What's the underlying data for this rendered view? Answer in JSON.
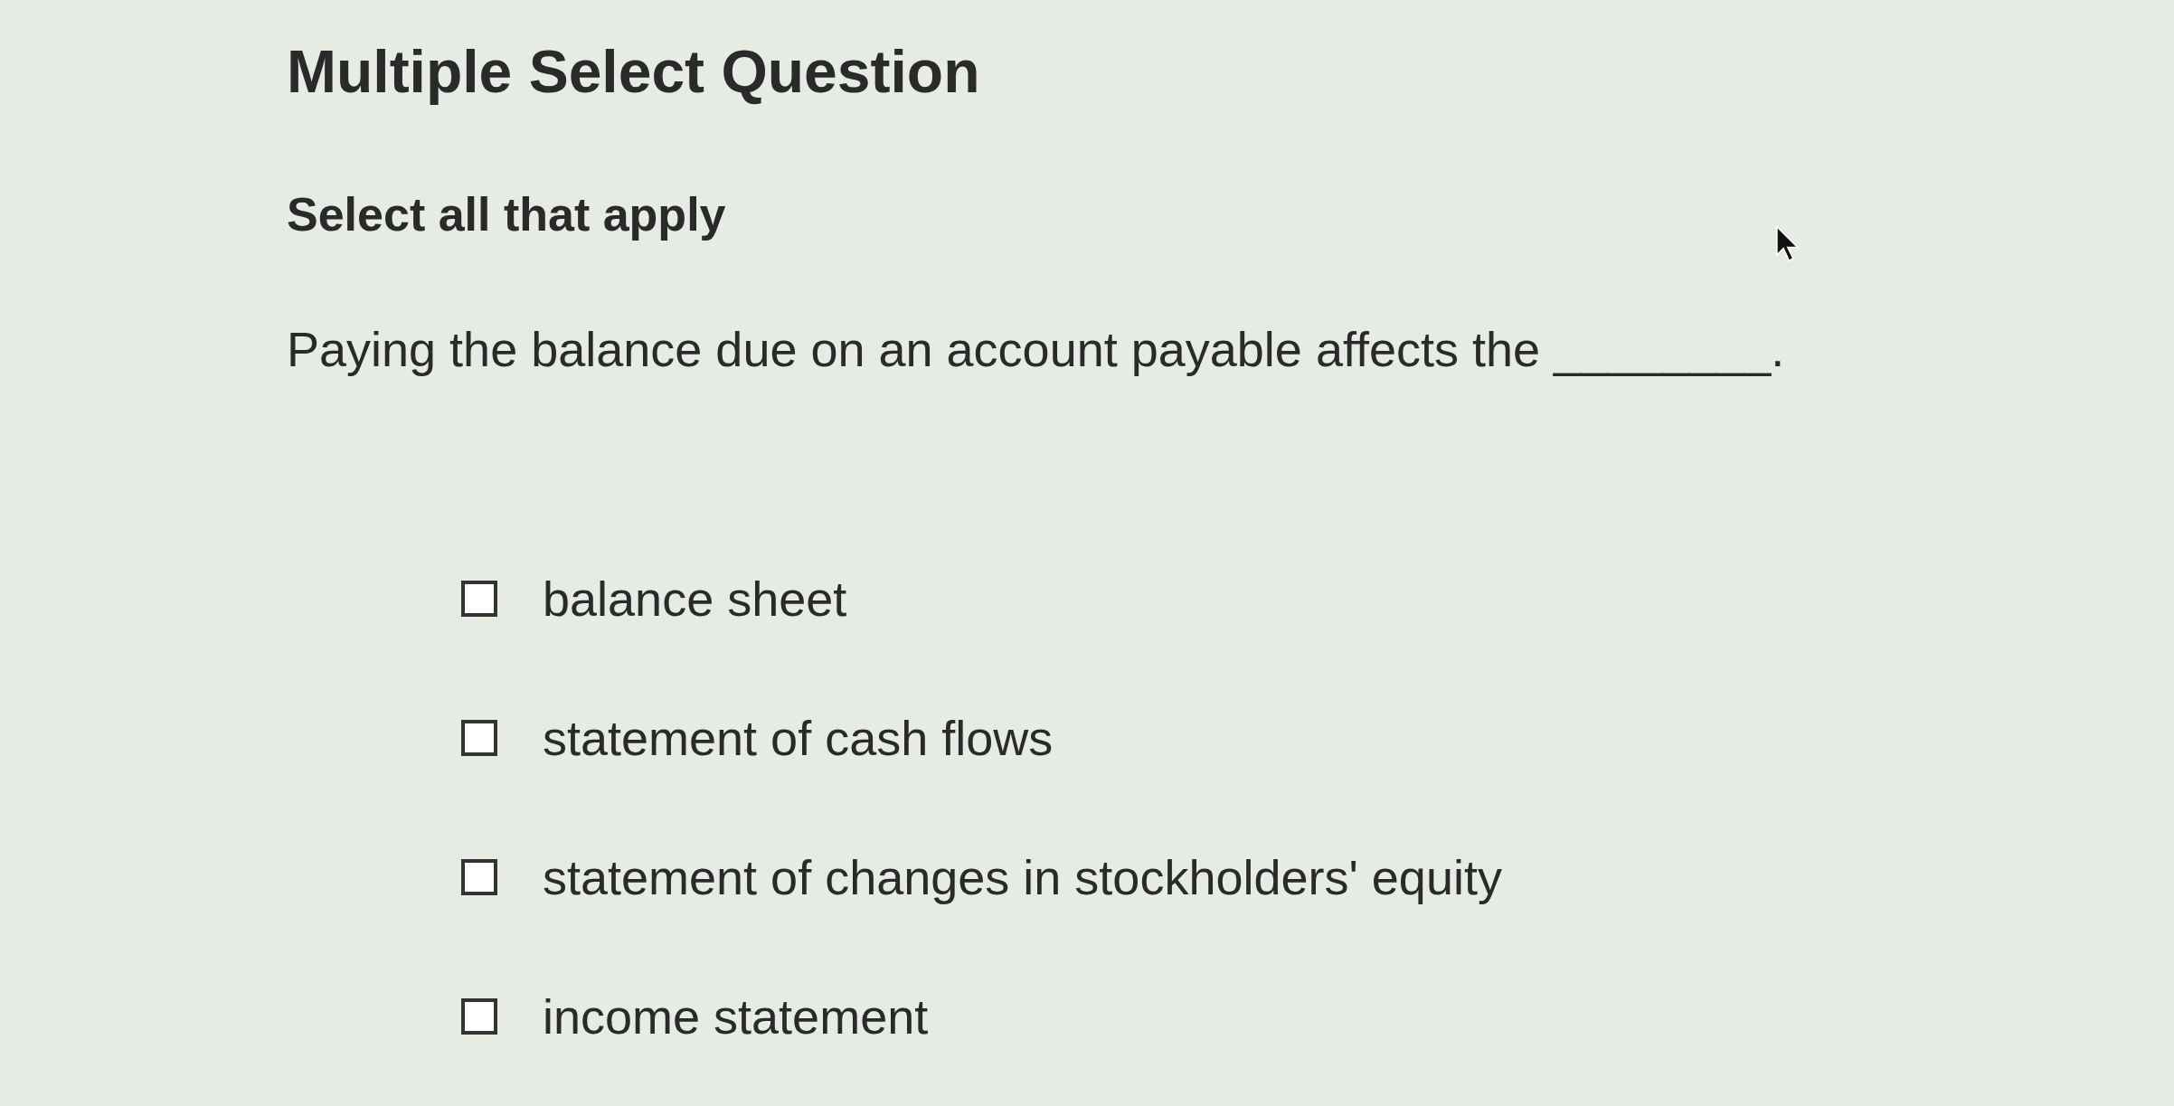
{
  "title": "Multiple Select Question",
  "instruction": "Select all that apply",
  "question": "Paying the balance due on an account payable affects the ________.",
  "options": [
    {
      "label": "balance sheet",
      "checked": false
    },
    {
      "label": "statement of cash flows",
      "checked": false
    },
    {
      "label": "statement of changes in stockholders' equity",
      "checked": false
    },
    {
      "label": "income statement",
      "checked": false
    }
  ]
}
